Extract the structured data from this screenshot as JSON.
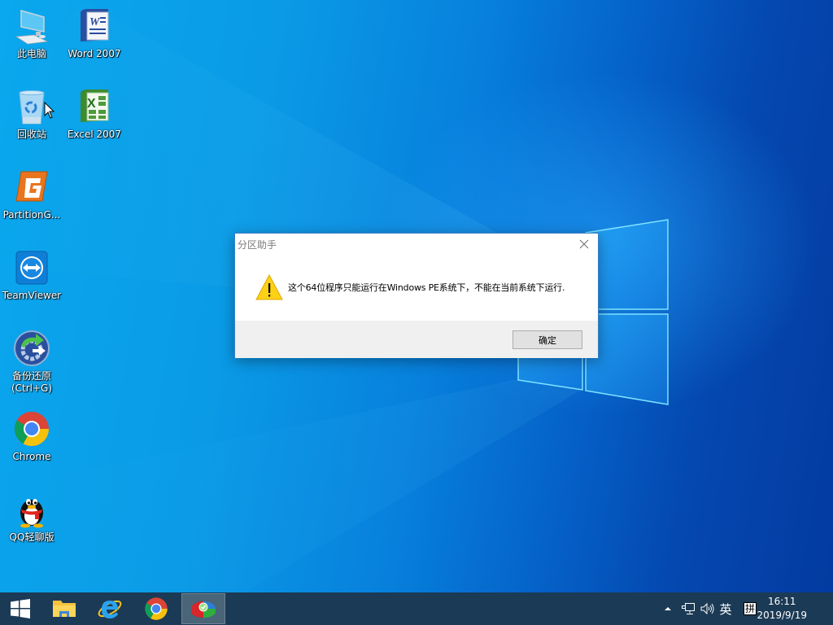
{
  "desktop": {
    "icons": [
      {
        "label": "此电脑",
        "icon": "computer-icon"
      },
      {
        "label": "Word 2007",
        "icon": "word-icon"
      },
      {
        "label": "回收站",
        "icon": "recycle-bin-icon"
      },
      {
        "label": "Excel 2007",
        "icon": "excel-icon"
      },
      {
        "label": "PartitionG...",
        "icon": "partition-guru-icon"
      },
      {
        "label": "TeamViewer",
        "icon": "teamviewer-icon"
      },
      {
        "label": "备份还原\n(Ctrl+G)",
        "icon": "backup-restore-icon"
      },
      {
        "label": "Chrome",
        "icon": "chrome-icon"
      },
      {
        "label": "QQ轻聊版",
        "icon": "qq-icon"
      }
    ]
  },
  "dialog": {
    "title": "分区助手",
    "message": "这个64位程序只能运行在Windows PE系统下，不能在当前系统下运行.",
    "ok_label": "确定",
    "icon": "warning-icon"
  },
  "taskbar": {
    "items": [
      {
        "name": "start",
        "icon": "windows-start-icon"
      },
      {
        "name": "file-explorer",
        "icon": "folder-icon"
      },
      {
        "name": "internet-explorer",
        "icon": "ie-icon"
      },
      {
        "name": "chrome",
        "icon": "chrome-icon"
      },
      {
        "name": "partition-assistant",
        "icon": "partition-assistant-icon",
        "active": true
      }
    ],
    "tray": {
      "ime_mode": "英",
      "ime_name": "拼",
      "time": "16:11",
      "date": "2019/9/19"
    }
  }
}
